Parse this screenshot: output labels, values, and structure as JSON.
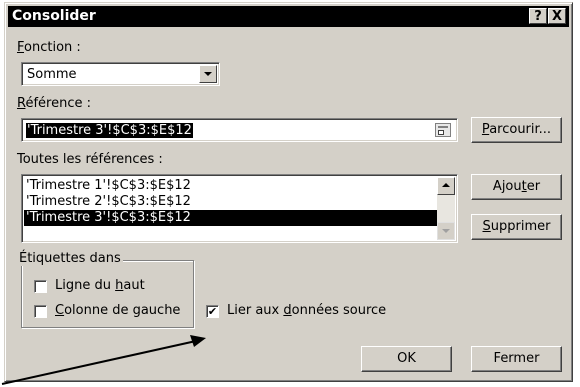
{
  "window": {
    "title": "Consolider",
    "help_btn": "?",
    "close_btn": "X"
  },
  "function": {
    "label_pre": "",
    "label_accel": "F",
    "label_post": "onction :",
    "value": "Somme"
  },
  "reference": {
    "label_pre": "",
    "label_accel": "R",
    "label_post": "éférence :",
    "value": "'Trimestre 3'!$C$3:$E$12",
    "browse_pre": "",
    "browse_accel": "P",
    "browse_post": "arcourir..."
  },
  "all_references": {
    "label": "Toutes les références :",
    "items": [
      "'Trimestre 1'!$C$3:$E$12",
      "'Trimestre 2'!$C$3:$E$12",
      "'Trimestre 3'!$C$3:$E$12"
    ],
    "selected_index": 2,
    "add_pre": "Ajou",
    "add_accel": "t",
    "add_post": "er",
    "delete_pre": "",
    "delete_accel": "S",
    "delete_post": "upprimer"
  },
  "labels_group": {
    "title": "Étiquettes dans",
    "top_row_pre": "Ligne du ",
    "top_row_accel": "h",
    "top_row_post": "aut",
    "top_row_checked": false,
    "left_col_pre": "",
    "left_col_accel": "C",
    "left_col_post": "olonne de gauche",
    "left_col_checked": false
  },
  "link_source": {
    "pre": "Lier aux ",
    "accel": "d",
    "post": "onnées source",
    "checked": true,
    "check_glyph": "✔"
  },
  "buttons": {
    "ok": "OK",
    "close": "Fermer"
  }
}
